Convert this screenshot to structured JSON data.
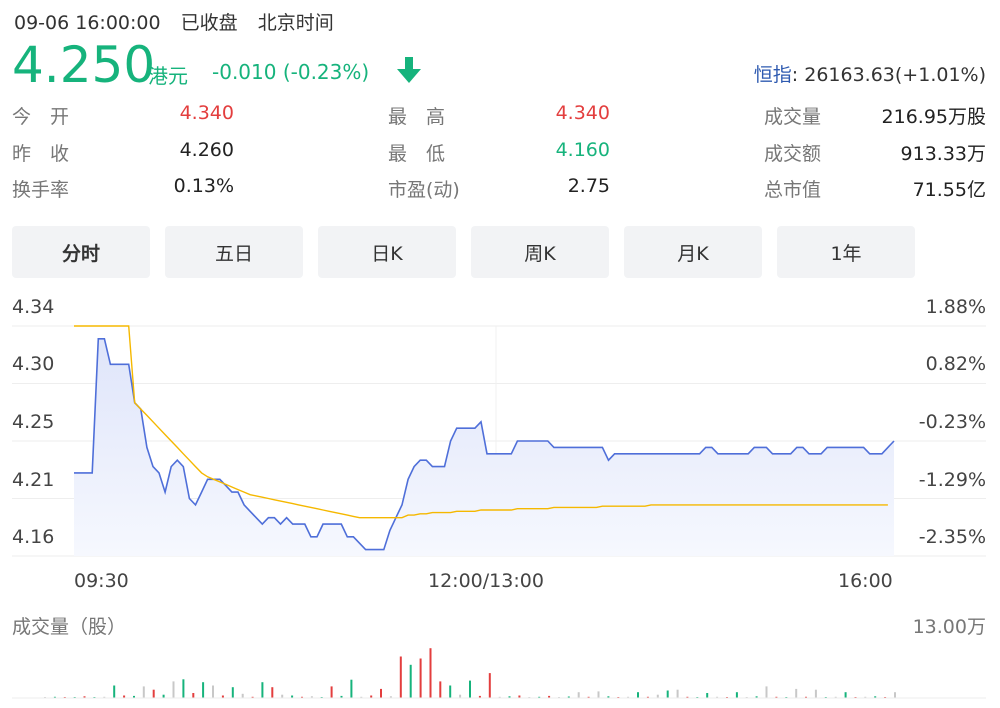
{
  "header": {
    "datetime": "09-06 16:00:00",
    "status": "已收盘",
    "timezone": "北京时间"
  },
  "quote": {
    "price": "4.250",
    "currency": "港元",
    "change": "-0.010 (-0.23%)",
    "direction": "down",
    "color_down": "#16b37c",
    "color_up": "#e33e3e"
  },
  "index": {
    "label": "恒指",
    "value": ": 26163.63(+1.01%)"
  },
  "stats": {
    "open_label": "今　开",
    "open": "4.340",
    "high_label": "最　高",
    "high": "4.340",
    "volume_label": "成交量",
    "volume": "216.95万股",
    "prev_close_label": "昨　收",
    "prev_close": "4.260",
    "low_label": "最　低",
    "low": "4.160",
    "turnover_label": "成交额",
    "turnover": "913.33万",
    "turnover_rate_label": "换手率",
    "turnover_rate": "0.13%",
    "pe_label": "市盈(动)",
    "pe": "2.75",
    "market_cap_label": "总市值",
    "market_cap": "71.55亿"
  },
  "tabs": [
    {
      "label": "分时",
      "active": true
    },
    {
      "label": "五日",
      "active": false
    },
    {
      "label": "日K",
      "active": false
    },
    {
      "label": "周K",
      "active": false
    },
    {
      "label": "月K",
      "active": false
    },
    {
      "label": "1年",
      "active": false
    }
  ],
  "chart_data": {
    "type": "line",
    "y_left_ticks": [
      "4.34",
      "4.30",
      "4.25",
      "4.21",
      "4.16"
    ],
    "y_right_ticks": [
      "1.88%",
      "0.82%",
      "-0.23%",
      "-1.29%",
      "-2.35%"
    ],
    "x_ticks": [
      "09:30",
      "12:00/13:00",
      "16:00"
    ],
    "ylim": [
      4.16,
      4.34
    ],
    "prev_close": 4.26,
    "colors": {
      "price": "#4f6fd9",
      "avg": "#f5b800",
      "fill": "#e8ecfb"
    },
    "series": [
      {
        "role": "price",
        "values": [
          4.225,
          4.225,
          4.225,
          4.225,
          4.33,
          4.33,
          4.31,
          4.31,
          4.31,
          4.31,
          4.28,
          4.275,
          4.245,
          4.23,
          4.225,
          4.21,
          4.23,
          4.235,
          4.23,
          4.205,
          4.2,
          4.21,
          4.22,
          4.22,
          4.22,
          4.215,
          4.21,
          4.21,
          4.2,
          4.195,
          4.19,
          4.185,
          4.19,
          4.19,
          4.185,
          4.19,
          4.185,
          4.185,
          4.185,
          4.175,
          4.175,
          4.185,
          4.185,
          4.185,
          4.185,
          4.175,
          4.175,
          4.17,
          4.165,
          4.165,
          4.165,
          4.165,
          4.18,
          4.19,
          4.2,
          4.22,
          4.23,
          4.235,
          4.235,
          4.23,
          4.23,
          4.23,
          4.25,
          4.26,
          4.26,
          4.26,
          4.26,
          4.265,
          4.24,
          4.24,
          4.24,
          4.24,
          4.24,
          4.25,
          4.25,
          4.25,
          4.25,
          4.25,
          4.25,
          4.245,
          4.245,
          4.245,
          4.245,
          4.245,
          4.245,
          4.245,
          4.245,
          4.245,
          4.235,
          4.24,
          4.24,
          4.24,
          4.24,
          4.24,
          4.24,
          4.24,
          4.24,
          4.24,
          4.24,
          4.24,
          4.24,
          4.24,
          4.24,
          4.24,
          4.245,
          4.245,
          4.24,
          4.24,
          4.24,
          4.24,
          4.24,
          4.24,
          4.245,
          4.245,
          4.245,
          4.24,
          4.24,
          4.24,
          4.24,
          4.245,
          4.245,
          4.24,
          4.24,
          4.24,
          4.245,
          4.245,
          4.245,
          4.245,
          4.245,
          4.245,
          4.245,
          4.24,
          4.24,
          4.24,
          4.245,
          4.25
        ]
      },
      {
        "role": "average",
        "values": [
          4.34,
          4.34,
          4.34,
          4.34,
          4.34,
          4.34,
          4.34,
          4.34,
          4.34,
          4.34,
          4.28,
          4.275,
          4.27,
          4.265,
          4.26,
          4.255,
          4.25,
          4.245,
          4.24,
          4.235,
          4.23,
          4.225,
          4.222,
          4.22,
          4.218,
          4.216,
          4.214,
          4.212,
          4.21,
          4.208,
          4.207,
          4.206,
          4.205,
          4.204,
          4.203,
          4.202,
          4.201,
          4.2,
          4.199,
          4.198,
          4.197,
          4.196,
          4.195,
          4.194,
          4.193,
          4.192,
          4.191,
          4.19,
          4.19,
          4.19,
          4.19,
          4.19,
          4.19,
          4.19,
          4.19,
          4.192,
          4.192,
          4.193,
          4.193,
          4.194,
          4.194,
          4.194,
          4.194,
          4.195,
          4.195,
          4.195,
          4.195,
          4.196,
          4.196,
          4.196,
          4.196,
          4.196,
          4.196,
          4.197,
          4.197,
          4.197,
          4.197,
          4.197,
          4.197,
          4.198,
          4.198,
          4.198,
          4.198,
          4.198,
          4.198,
          4.198,
          4.198,
          4.199,
          4.199,
          4.199,
          4.199,
          4.199,
          4.199,
          4.199,
          4.199,
          4.2,
          4.2,
          4.2,
          4.2,
          4.2,
          4.2,
          4.2,
          4.2,
          4.2,
          4.2,
          4.2,
          4.2,
          4.2,
          4.2,
          4.2,
          4.2,
          4.2,
          4.2,
          4.2,
          4.2,
          4.2,
          4.2,
          4.2,
          4.2,
          4.2,
          4.2,
          4.2,
          4.2,
          4.2,
          4.2,
          4.2,
          4.2,
          4.2,
          4.2,
          4.2,
          4.2,
          4.2,
          4.2,
          4.2,
          4.2
        ]
      }
    ]
  },
  "volume": {
    "title": "成交量（股）",
    "max_label": "13.00万",
    "max_value": 130000,
    "colors": {
      "up": "#e33e3e",
      "down": "#16b37c",
      "flat": "#c8c8c8"
    },
    "bars": [
      {
        "v": 2000,
        "d": "flat"
      },
      {
        "v": 3000,
        "d": "down"
      },
      {
        "v": 1500,
        "d": "up"
      },
      {
        "v": 2000,
        "d": "down"
      },
      {
        "v": 4000,
        "d": "up"
      },
      {
        "v": 2500,
        "d": "down"
      },
      {
        "v": 3000,
        "d": "flat"
      },
      {
        "v": 30000,
        "d": "down"
      },
      {
        "v": 6000,
        "d": "up"
      },
      {
        "v": 5000,
        "d": "down"
      },
      {
        "v": 28000,
        "d": "flat"
      },
      {
        "v": 20000,
        "d": "up"
      },
      {
        "v": 8000,
        "d": "down"
      },
      {
        "v": 40000,
        "d": "flat"
      },
      {
        "v": 45000,
        "d": "down"
      },
      {
        "v": 12000,
        "d": "up"
      },
      {
        "v": 38000,
        "d": "down"
      },
      {
        "v": 30000,
        "d": "flat"
      },
      {
        "v": 6000,
        "d": "up"
      },
      {
        "v": 26000,
        "d": "down"
      },
      {
        "v": 10000,
        "d": "flat"
      },
      {
        "v": 3000,
        "d": "up"
      },
      {
        "v": 38000,
        "d": "down"
      },
      {
        "v": 26000,
        "d": "up"
      },
      {
        "v": 8000,
        "d": "flat"
      },
      {
        "v": 6000,
        "d": "down"
      },
      {
        "v": 3000,
        "d": "up"
      },
      {
        "v": 4000,
        "d": "flat"
      },
      {
        "v": 2000,
        "d": "down"
      },
      {
        "v": 28000,
        "d": "up"
      },
      {
        "v": 5000,
        "d": "down"
      },
      {
        "v": 44000,
        "d": "down"
      },
      {
        "v": 3000,
        "d": "flat"
      },
      {
        "v": 6000,
        "d": "up"
      },
      {
        "v": 22000,
        "d": "up"
      },
      {
        "v": 4000,
        "d": "flat"
      },
      {
        "v": 100000,
        "d": "up"
      },
      {
        "v": 80000,
        "d": "down"
      },
      {
        "v": 95000,
        "d": "up"
      },
      {
        "v": 120000,
        "d": "up"
      },
      {
        "v": 40000,
        "d": "up"
      },
      {
        "v": 30000,
        "d": "down"
      },
      {
        "v": 8000,
        "d": "flat"
      },
      {
        "v": 42000,
        "d": "down"
      },
      {
        "v": 5000,
        "d": "up"
      },
      {
        "v": 60000,
        "d": "up"
      },
      {
        "v": 3000,
        "d": "flat"
      },
      {
        "v": 4000,
        "d": "down"
      },
      {
        "v": 6000,
        "d": "up"
      },
      {
        "v": 2500,
        "d": "flat"
      },
      {
        "v": 3000,
        "d": "down"
      },
      {
        "v": 5000,
        "d": "up"
      },
      {
        "v": 2000,
        "d": "flat"
      },
      {
        "v": 3500,
        "d": "down"
      },
      {
        "v": 14000,
        "d": "flat"
      },
      {
        "v": 3000,
        "d": "up"
      },
      {
        "v": 16000,
        "d": "flat"
      },
      {
        "v": 4000,
        "d": "down"
      },
      {
        "v": 2500,
        "d": "up"
      },
      {
        "v": 3000,
        "d": "flat"
      },
      {
        "v": 14000,
        "d": "down"
      },
      {
        "v": 3000,
        "d": "up"
      },
      {
        "v": 8000,
        "d": "flat"
      },
      {
        "v": 18000,
        "d": "down"
      },
      {
        "v": 20000,
        "d": "flat"
      },
      {
        "v": 3000,
        "d": "up"
      },
      {
        "v": 2500,
        "d": "down"
      },
      {
        "v": 12000,
        "d": "down"
      },
      {
        "v": 3000,
        "d": "flat"
      },
      {
        "v": 2500,
        "d": "up"
      },
      {
        "v": 14000,
        "d": "down"
      },
      {
        "v": 2000,
        "d": "flat"
      },
      {
        "v": 4000,
        "d": "down"
      },
      {
        "v": 28000,
        "d": "flat"
      },
      {
        "v": 3000,
        "d": "up"
      },
      {
        "v": 2500,
        "d": "down"
      },
      {
        "v": 22000,
        "d": "flat"
      },
      {
        "v": 3000,
        "d": "up"
      },
      {
        "v": 20000,
        "d": "flat"
      },
      {
        "v": 2500,
        "d": "down"
      },
      {
        "v": 3000,
        "d": "flat"
      },
      {
        "v": 14000,
        "d": "down"
      },
      {
        "v": 2000,
        "d": "up"
      },
      {
        "v": 3000,
        "d": "flat"
      },
      {
        "v": 4000,
        "d": "down"
      },
      {
        "v": 2500,
        "d": "up"
      },
      {
        "v": 14000,
        "d": "flat"
      }
    ]
  }
}
